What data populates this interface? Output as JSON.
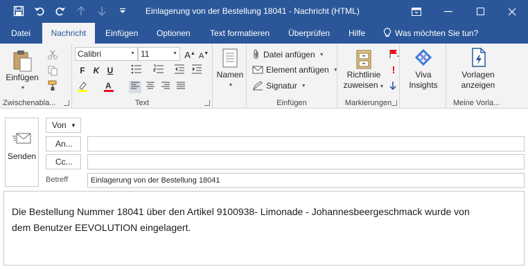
{
  "window": {
    "title": "Einlagerung von der Bestellung 18041  -  Nachricht (HTML)"
  },
  "tabs": [
    {
      "label": "Datei"
    },
    {
      "label": "Nachricht"
    },
    {
      "label": "Einfügen"
    },
    {
      "label": "Optionen"
    },
    {
      "label": "Text formatieren"
    },
    {
      "label": "Überprüfen"
    },
    {
      "label": "Hilfe"
    }
  ],
  "tell_me": "Was möchten Sie tun?",
  "ribbon": {
    "clipboard": {
      "paste_label": "Einfügen",
      "group_label": "Zwischenabla..."
    },
    "text": {
      "font_name": "Calibri",
      "font_size": "11",
      "group_label": "Text"
    },
    "names": {
      "label": "Namen"
    },
    "include": {
      "attach_file": "Datei anfügen",
      "attach_item": "Element anfügen",
      "signature": "Signatur",
      "group_label": "Einfügen"
    },
    "tags": {
      "policy_line1": "Richtlinie",
      "policy_line2": "zuweisen",
      "group_label": "Markierungen"
    },
    "viva": {
      "line1": "Viva",
      "line2": "Insights"
    },
    "templates": {
      "line1": "Vorlagen",
      "line2": "anzeigen",
      "group_label": "Meine Vorla..."
    }
  },
  "compose": {
    "send_label": "Senden",
    "from_label": "Von",
    "to_label": "An...",
    "cc_label": "Cc...",
    "to_value": "",
    "cc_value": "",
    "subject_label": "Betreff",
    "subject_value": "Einlagerung von der Bestellung 18041",
    "body_line1": "Die Bestellung Nummer 18041 über den Artikel 9100938- Limonade - Johannesbeergeschmack wurde von",
    "body_line2": "dem Benutzer EEVOLUTION eingelagert."
  },
  "colors": {
    "accent": "#2b579a",
    "ribbon_bg": "#f3f3f3",
    "highlight": "#ffff00",
    "font_color": "#e81123",
    "flag": "#e81123"
  }
}
